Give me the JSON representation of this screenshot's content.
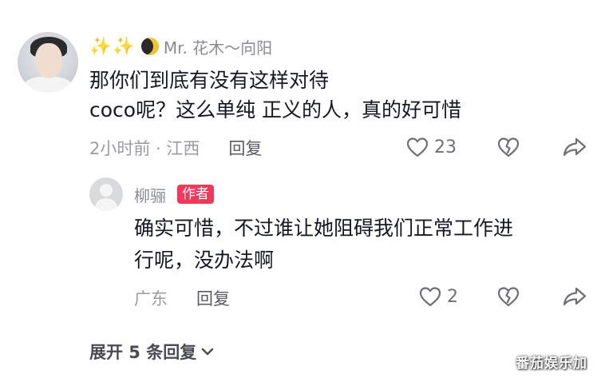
{
  "comment": {
    "username": "Mr. 花木～向阳",
    "username_decor": [
      "✨",
      "✨"
    ],
    "text_lines": [
      "那你们到底有没有这样对待",
      "coco呢？这么单纯 正义的人，真的好可惜"
    ],
    "meta": "2小时前 · 江西",
    "reply_label": "回复",
    "like_count": "23"
  },
  "reply": {
    "username": "柳骊",
    "badge": "作者",
    "text_lines": [
      "确实可惜，不过谁让她阻碍我们正常工作进",
      "行呢，没办法啊"
    ],
    "meta": "广东",
    "reply_label": "回复",
    "like_count": "2"
  },
  "expand": {
    "label": "展开 5 条回复"
  },
  "watermark": "番茄娱乐加",
  "colors": {
    "text": "#161823",
    "meta": "#9b9ca1",
    "badge_bg": "#f4385b",
    "sparkle": "#f3d46a"
  },
  "icons": [
    "heart-icon",
    "dislike-icon",
    "share-icon",
    "chevron-down-icon"
  ]
}
